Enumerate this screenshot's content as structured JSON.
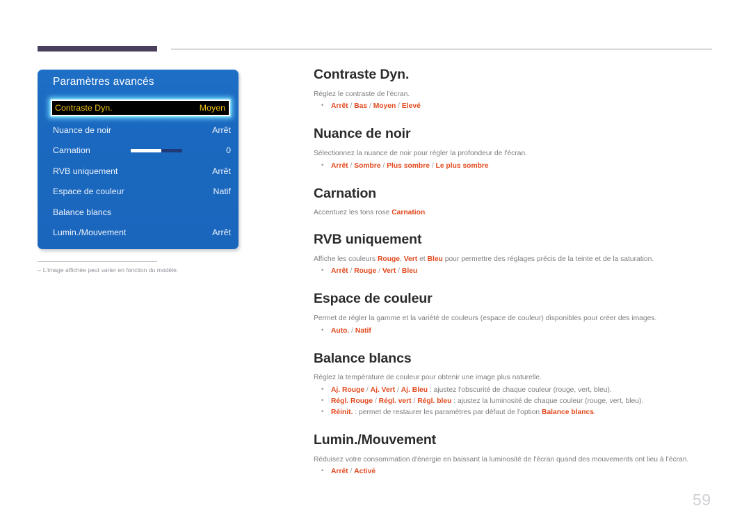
{
  "osd": {
    "title": "Paramètres avancés",
    "rows": [
      {
        "label": "Contraste Dyn.",
        "value": "Moyen",
        "selected": true,
        "slider": null
      },
      {
        "label": "Nuance de noir",
        "value": "Arrêt",
        "selected": false,
        "slider": null
      },
      {
        "label": "Carnation",
        "value": "0",
        "selected": false,
        "slider": 60
      },
      {
        "label": "RVB uniquement",
        "value": "Arrêt",
        "selected": false,
        "slider": null
      },
      {
        "label": "Espace de couleur",
        "value": "Natif",
        "selected": false,
        "slider": null
      },
      {
        "label": "Balance blancs",
        "value": "",
        "selected": false,
        "slider": null
      },
      {
        "label": "Lumin./Mouvement",
        "value": "Arrêt",
        "selected": false,
        "slider": null
      }
    ]
  },
  "footnote": {
    "dash": "‒",
    "text": "L'image affichée peut varier en fonction du modèle."
  },
  "sections": {
    "contraste": {
      "title": "Contraste Dyn.",
      "desc": "Réglez le contraste de l'écran.",
      "bullet": {
        "opts": [
          "Arrêt",
          "Bas",
          "Moyen",
          "Elevé"
        ]
      }
    },
    "nuance": {
      "title": "Nuance de noir",
      "desc": "Sélectionnez la nuance de noir pour régler la profondeur de l'écran.",
      "bullet": {
        "opts": [
          "Arrêt",
          "Sombre",
          "Plus sombre",
          "Le plus sombre"
        ]
      }
    },
    "carnation": {
      "title": "Carnation",
      "desc_pre": "Accentuez les tons rose ",
      "desc_hl": "Carnation",
      "desc_post": "."
    },
    "rvb": {
      "title": "RVB uniquement",
      "desc_a": "Affiche les couleurs ",
      "desc_hl1": "Rouge",
      "desc_b": ", ",
      "desc_hl2": "Vert",
      "desc_c": " et ",
      "desc_hl3": "Bleu",
      "desc_d": " pour permettre des réglages précis de la teinte et de la saturation.",
      "bullet": {
        "opts": [
          "Arrêt",
          "Rouge",
          "Vert",
          "Bleu"
        ]
      }
    },
    "espace": {
      "title": "Espace de couleur",
      "desc": "Permet de régler la gamme et la variété de couleurs (espace de couleur) disponibles pour créer des images.",
      "bullet": {
        "opts": [
          "Auto.",
          "Natif"
        ]
      }
    },
    "balance": {
      "title": "Balance blancs",
      "desc": "Réglez la température de couleur pour obtenir une image plus naturelle.",
      "bullets": [
        {
          "opts": [
            "Aj. Rouge",
            "Aj. Vert",
            "Aj. Bleu"
          ],
          "rest": " : ajustez l'obscurité de chaque couleur (rouge, vert, bleu)."
        },
        {
          "opts": [
            "Régl. Rouge",
            "Régl. vert",
            "Régl. bleu"
          ],
          "rest": " : ajustez la luminosité de chaque couleur (rouge, vert, bleu)."
        },
        {
          "opts": [
            "Réinit."
          ],
          "rest_pre": " : permet de restaurer les paramètres par défaut de l'option ",
          "rest_hl": "Balance blancs",
          "rest_post": "."
        }
      ]
    },
    "lumin": {
      "title": "Lumin./Mouvement",
      "desc": "Réduisez votre consommation d'énergie en baissant la luminosité de l'écran quand des mouvements ont lieu à l'écran.",
      "bullet": {
        "opts": [
          "Arrêt",
          "Activé"
        ]
      }
    }
  },
  "page_number": "59",
  "colors": {
    "accent_red": "#e2491e",
    "osd_blue": "#1a68bf",
    "highlight_text": "#f5c518",
    "header_bar": "#4a3f5c"
  }
}
